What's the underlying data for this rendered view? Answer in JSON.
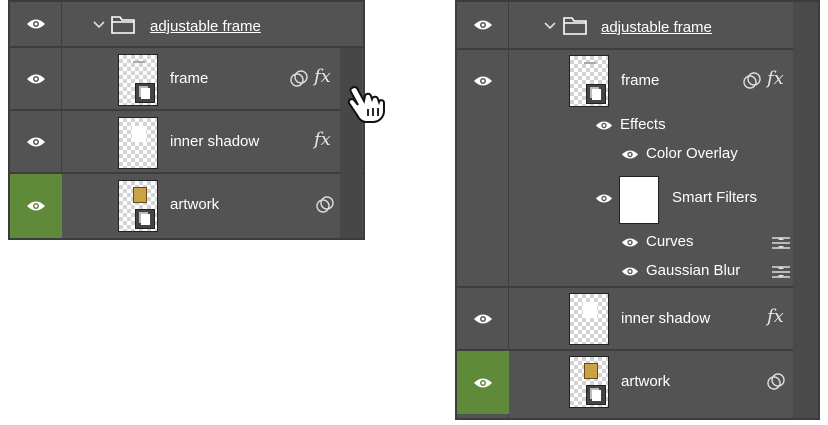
{
  "left_panel": {
    "group": {
      "label": "adjustable frame"
    },
    "layers": [
      {
        "name": "frame",
        "fx": "fx"
      },
      {
        "name": "inner shadow",
        "fx": "fx"
      },
      {
        "name": "artwork"
      }
    ]
  },
  "right_panel": {
    "group": {
      "label": "adjustable frame"
    },
    "frame_layer": {
      "name": "frame",
      "fx": "fx"
    },
    "effects": {
      "label": "Effects",
      "color_overlay": "Color Overlay"
    },
    "smart_filters": {
      "label": "Smart Filters",
      "curves": "Curves",
      "gaussian_blur": "Gaussian Blur"
    },
    "inner_shadow_layer": {
      "name": "inner shadow",
      "fx": "fx"
    },
    "artwork_layer": {
      "name": "artwork"
    }
  },
  "colors": {
    "panel": "#535353",
    "visible_green": "#5f8a3a"
  }
}
